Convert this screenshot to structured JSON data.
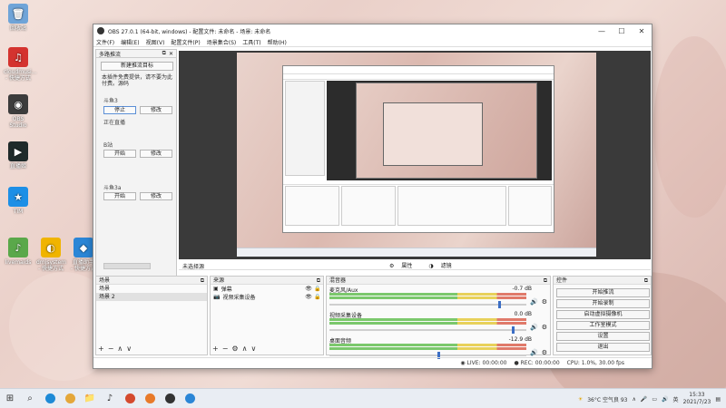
{
  "desktop": {
    "icons": [
      {
        "label": "回收站",
        "color": "#6fa4d8",
        "glyph": "🗑"
      },
      {
        "label": "cloudmusi...\n- 快捷方式",
        "color": "#d4332f",
        "glyph": "♫"
      },
      {
        "label": "OBS Studio",
        "color": "#3c3c3c",
        "glyph": "◉"
      },
      {
        "label": "直播姬",
        "color": "#1f2a2a",
        "glyph": "▶"
      },
      {
        "label": "TIM",
        "color": "#1d8fe6",
        "glyph": "★"
      },
      {
        "label": "livemaids",
        "color": "#5aa84a",
        "glyph": "♪"
      },
      {
        "label": "dmjsystem\n- 快捷方式",
        "color": "#f0b400",
        "glyph": "◐"
      },
      {
        "label": "直播助手\n- 快捷方式",
        "color": "#2b86d6",
        "glyph": "◆"
      }
    ]
  },
  "obs": {
    "title": "OBS 27.0.1 (64-bit, windows) - 配置文件: 未命名 - 场景: 未命名",
    "window_controls": {
      "minimize": "—",
      "maximize": "☐",
      "close": "✕"
    },
    "menu": [
      "文件(F)",
      "编辑(E)",
      "视图(V)",
      "配置文件(P)",
      "场景集合(S)",
      "工具(T)",
      "帮助(H)"
    ],
    "dock": {
      "title": "多路推流",
      "new_target_label": "新建推流目标",
      "note": "本插件免费提供，请不要为此付费。源码",
      "groups": [
        {
          "name": "斗鱼3",
          "start_label": "停止",
          "edit_label": "修改",
          "status": "正在直播"
        },
        {
          "name": "B站",
          "start_label": "开始",
          "edit_label": "修改",
          "status": ""
        },
        {
          "name": "斗鱼3a",
          "start_label": "开始",
          "edit_label": "修改",
          "status": ""
        }
      ]
    },
    "modebar": {
      "scene_label": "未选择源",
      "properties_label": "属性",
      "filters_label": "滤镜"
    },
    "scenes": {
      "title": "场景",
      "items": [
        "场景",
        "场景 2"
      ],
      "selected": 1
    },
    "sources": {
      "title": "来源",
      "items": [
        {
          "name": "弹幕",
          "icon": "▣"
        },
        {
          "name": "视频采集设备",
          "icon": "📷"
        }
      ]
    },
    "mixer": {
      "title": "混音器",
      "channels": [
        {
          "name": "麦克风/Aux",
          "db": "-0.7 dB",
          "level": 0.86
        },
        {
          "name": "视频采集设备",
          "db": "0.0 dB",
          "level": 0.93
        },
        {
          "name": "桌面音频",
          "db": "-12.9 dB",
          "level": 0.55
        }
      ]
    },
    "controls": {
      "title": "控件",
      "buttons": [
        "开始推流",
        "开始录制",
        "启动虚拟摄像机",
        "工作室模式",
        "设置",
        "退出"
      ]
    },
    "status": {
      "live_label": "LIVE:",
      "live_time": "00:00:00",
      "rec_label": "REC:",
      "rec_time": "00:00:00",
      "cpu": "CPU: 1.0%, 30.00 fps"
    }
  },
  "taskbar": {
    "weather": "36°C  空气良 93",
    "time": "15:33",
    "date": "2021/7/23",
    "ime": "英"
  }
}
